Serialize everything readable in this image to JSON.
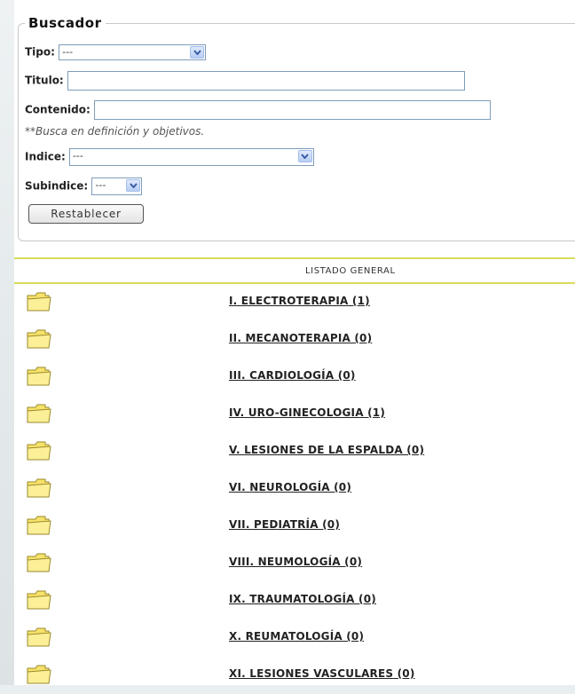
{
  "search": {
    "legend": "Buscador",
    "tipo_label": "Tipo:",
    "tipo_value": "---",
    "titulo_label": "Titulo:",
    "titulo_value": "",
    "contenido_label": "Contenido:",
    "contenido_value": "",
    "contenido_note": "**Busca en definición y objetivos.",
    "indice_label": "Indice:",
    "indice_value": "---",
    "subindice_label": "Subindice:",
    "subindice_value": "---",
    "reset_label": "Restablecer"
  },
  "listing": {
    "header": "LISTADO GENERAL",
    "items": [
      {
        "label": "I. ELECTROTERAPIA (1)"
      },
      {
        "label": "II. MECANOTERAPIA (0)"
      },
      {
        "label": "III. CARDIOLOGÍA  (0)"
      },
      {
        "label": "IV. URO-GINECOLOGIA  (1)"
      },
      {
        "label": "V. LESIONES DE LA ESPALDA (0)"
      },
      {
        "label": "VI. NEUROLOGÍA  (0)"
      },
      {
        "label": "VII. PEDIATRÍA  (0)"
      },
      {
        "label": "VIII. NEUMOLOGÍA  (0)"
      },
      {
        "label": "IX. TRAUMATOLOGÍA  (0)"
      },
      {
        "label": "X. REUMATOLOGÍA  (0)"
      },
      {
        "label": "XI. LESIONES VASCULARES  (0)"
      }
    ]
  },
  "colors": {
    "accent_line": "#d8dc5a",
    "folder": "#f7e26a"
  },
  "icons": {
    "folder": "folder-icon",
    "select_arrow": "chevron-down-icon"
  }
}
